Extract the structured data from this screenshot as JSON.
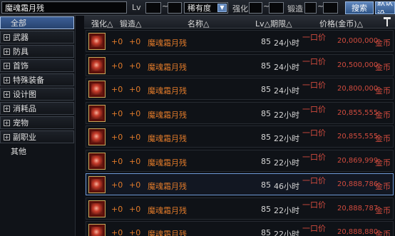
{
  "search": {
    "query": "魔魂霜月残"
  },
  "filters": {
    "lv_label": "Lv",
    "lv_sep": "~",
    "rarity_label": "稀有度",
    "enhance_label": "强化",
    "enhance_sep": "~",
    "forge_label": "锻造",
    "forge_sep": "~"
  },
  "buttons": {
    "search": "搜索",
    "default": "默认设"
  },
  "sidebar": {
    "items": [
      {
        "label": "全部",
        "active": true,
        "icon": false
      },
      {
        "label": "武器",
        "icon": true
      },
      {
        "label": "防具",
        "icon": true
      },
      {
        "label": "首饰",
        "icon": true
      },
      {
        "label": "特殊装备",
        "icon": true
      },
      {
        "label": "设计图",
        "icon": true
      },
      {
        "label": "消耗品",
        "icon": true
      },
      {
        "label": "宠物",
        "icon": true
      },
      {
        "label": "副职业",
        "icon": true
      },
      {
        "label": "其他",
        "icon": false
      }
    ]
  },
  "table": {
    "headers": {
      "enhance": "强化△",
      "forge": "锻造△",
      "name": "名称△",
      "lv_time": "Lv△期限△",
      "price": "价格(金币)△"
    },
    "rows": [
      {
        "enh": "+0",
        "forge": "+0",
        "name": "魔魂霜月残",
        "lv": "85",
        "time": "24小时",
        "tag": "一口价",
        "price": "20,000,000",
        "unit": "金币"
      },
      {
        "enh": "+0",
        "forge": "+0",
        "name": "魔魂霜月残",
        "lv": "85",
        "time": "24小时",
        "tag": "一口价",
        "price": "20,500,000",
        "unit": "金币"
      },
      {
        "enh": "+0",
        "forge": "+0",
        "name": "魔魂霜月残",
        "lv": "85",
        "time": "24小时",
        "tag": "一口价",
        "price": "20,800,000",
        "unit": "金币"
      },
      {
        "enh": "+0",
        "forge": "+0",
        "name": "魔魂霜月残",
        "lv": "85",
        "time": "22小时",
        "tag": "一口价",
        "price": "20,855,555",
        "unit": "金币"
      },
      {
        "enh": "+0",
        "forge": "+0",
        "name": "魔魂霜月残",
        "lv": "85",
        "time": "22小时",
        "tag": "一口价",
        "price": "20,855,555",
        "unit": "金币"
      },
      {
        "enh": "+0",
        "forge": "+0",
        "name": "魔魂霜月残",
        "lv": "85",
        "time": "22小时",
        "tag": "一口价",
        "price": "20,869,999",
        "unit": "金币"
      },
      {
        "enh": "+0",
        "forge": "+0",
        "name": "魔魂霜月残",
        "lv": "85",
        "time": "46小时",
        "tag": "一口价",
        "price": "20,888,786",
        "unit": "金币"
      },
      {
        "enh": "+0",
        "forge": "+0",
        "name": "魔魂霜月残",
        "lv": "85",
        "time": "22小时",
        "tag": "一口价",
        "price": "20,888,787",
        "unit": "金币"
      },
      {
        "enh": "+0",
        "forge": "+0",
        "name": "魔魂霜月残",
        "lv": "85",
        "time": "22小时",
        "tag": "一口价",
        "price": "20,888,880",
        "unit": "金币"
      }
    ],
    "selected_row": 6
  }
}
